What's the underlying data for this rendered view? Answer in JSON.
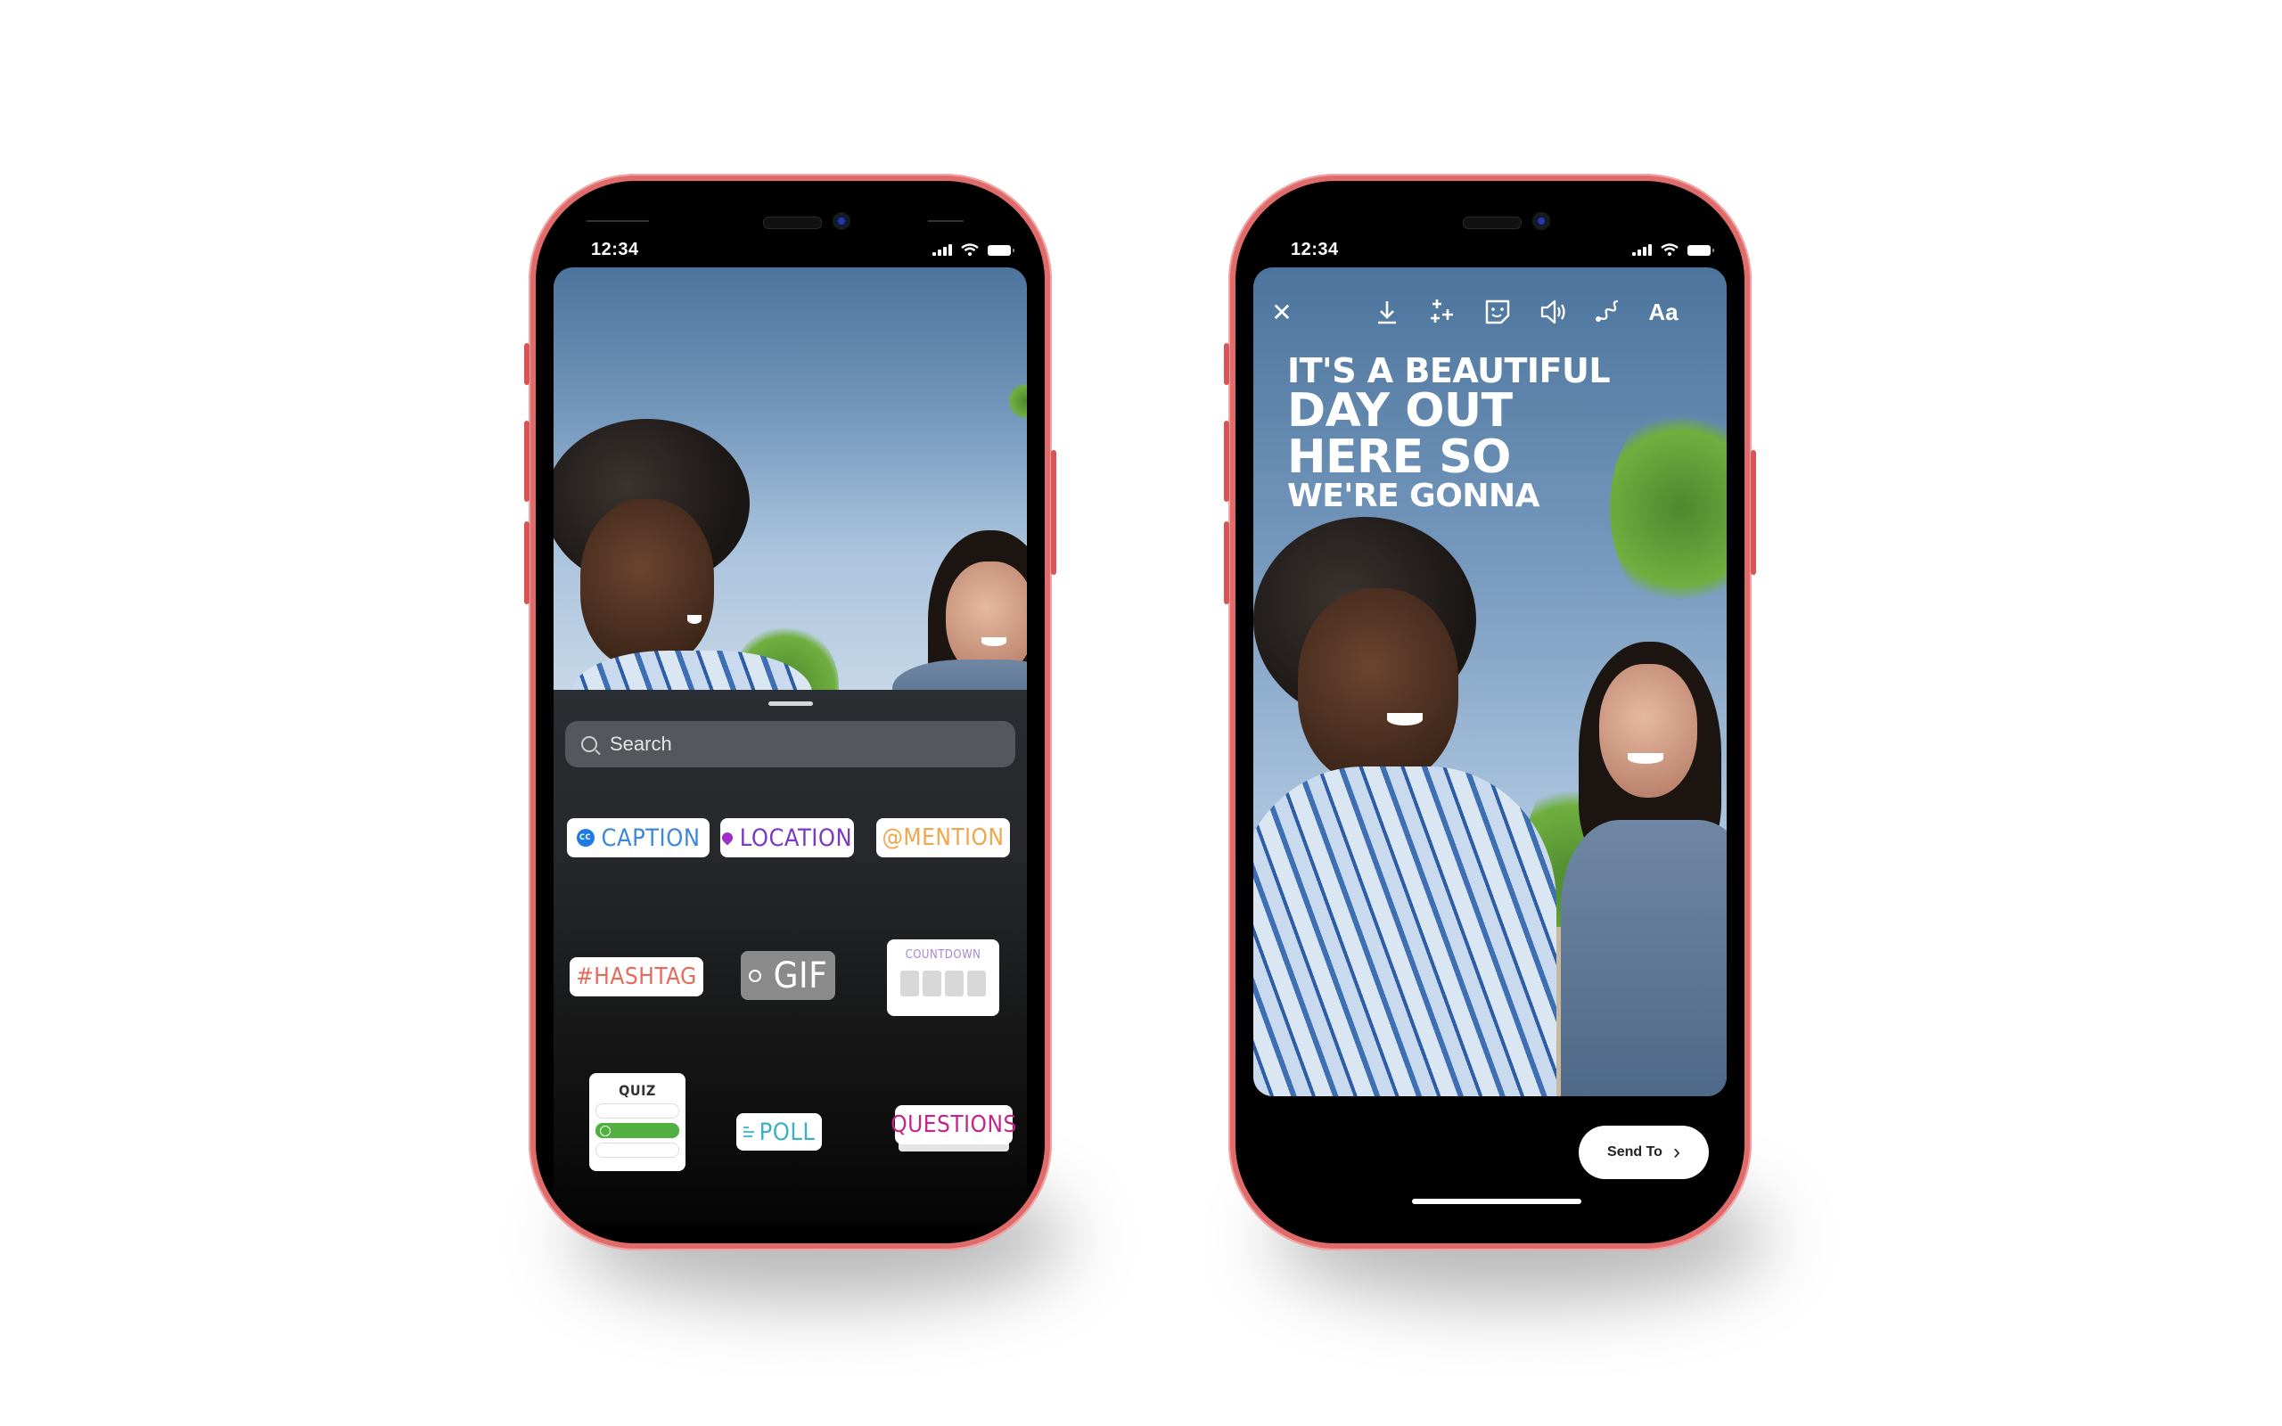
{
  "colors": {
    "phone_frame": "#e06b6b",
    "background": "#ffffff",
    "caption": "#3e88d4",
    "location": "#7a3ac4",
    "mention": "#f0a64a",
    "hashtag": "#e86a5a",
    "poll": "#3bb0c9",
    "questions": "#c2268a",
    "quiz_correct": "#52b043"
  },
  "left_phone": {
    "status_bar": {
      "time": "12:34",
      "icons": [
        "signal-icon",
        "wifi-icon",
        "battery-icon"
      ]
    },
    "sticker_tray": {
      "search": {
        "placeholder": "Search",
        "value": ""
      },
      "stickers": {
        "caption": {
          "label": "CAPTION",
          "icon": "cc-icon",
          "icon_text": "CC"
        },
        "location": {
          "label": "LOCATION",
          "icon": "pin-icon"
        },
        "mention": {
          "label": "@MENTION"
        },
        "hashtag": {
          "label": "#HASHTAG"
        },
        "gif": {
          "label": "GIF",
          "icon": "search-icon"
        },
        "countdown": {
          "label": "COUNTDOWN"
        },
        "quiz": {
          "label": "QUIZ"
        },
        "poll": {
          "label": "POLL",
          "icon": "poll-lines-icon"
        },
        "questions": {
          "label": "QUESTIONS"
        }
      }
    }
  },
  "right_phone": {
    "status_bar": {
      "time": "12:34",
      "icons": [
        "signal-icon",
        "wifi-icon",
        "battery-icon"
      ]
    },
    "toolbar": {
      "close": "✕",
      "download": "⤓",
      "effects": "✦",
      "sticker": "☺",
      "sound": "🔈",
      "draw": "〰",
      "text": "Aa"
    },
    "overlay_text": {
      "line1": "IT'S A BEAUTIFUL",
      "line2": "DAY OUT",
      "line3": "HERE SO",
      "line4": "WE'RE GONNA"
    },
    "send_to": {
      "label": "Send To",
      "chevron": "›"
    }
  }
}
